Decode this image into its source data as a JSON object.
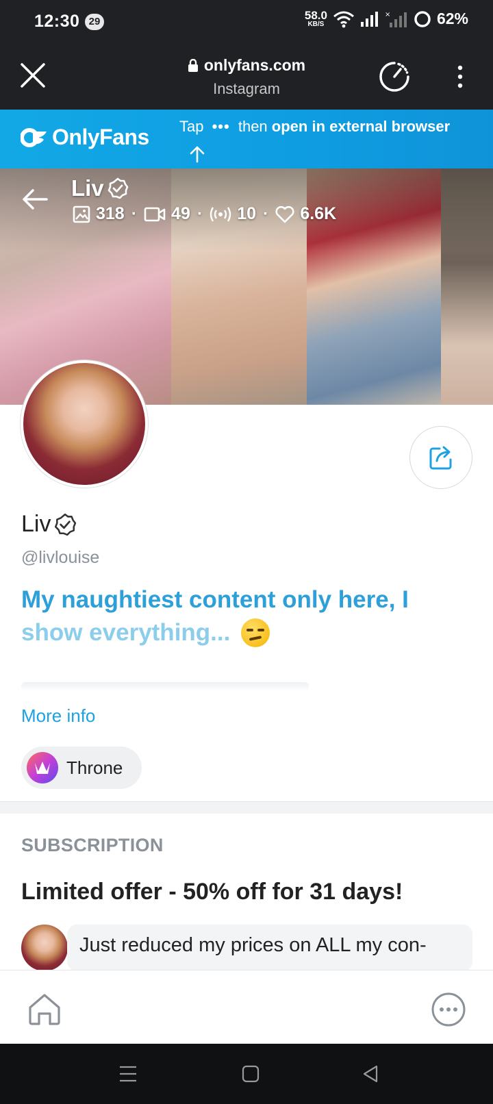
{
  "status_bar": {
    "time": "12:30",
    "notification_count": "29",
    "net_speed": "58.0",
    "net_speed_unit": "KB/S",
    "battery": "62%"
  },
  "browser": {
    "domain": "onlyfans.com",
    "source": "Instagram"
  },
  "banner": {
    "brand": "OnlyFans",
    "tip_prefix": "Tap",
    "tip_dots": "•••",
    "tip_middle": "then",
    "tip_bold": "open in external browser"
  },
  "profile": {
    "cover_name": "Liv",
    "stats": {
      "photos": "318",
      "videos": "49",
      "streams": "10",
      "likes": "6.6K"
    },
    "name": "Liv",
    "handle": "@livlouise",
    "bio_line1": "My naughtiest content only here, I",
    "bio_line2": "show everything...",
    "more_info": "More info",
    "chip_label": "Throne"
  },
  "subscription": {
    "heading": "SUBSCRIPTION",
    "offer": "Limited offer - 50% off for 31 days!",
    "message": "Just reduced my prices on ALL my con-"
  },
  "colors": {
    "of_blue": "#12a8e5",
    "link_blue": "#1da1df",
    "bio_blue": "#2d9fd9"
  },
  "icons": {
    "close": "close-icon",
    "lock": "lock-icon",
    "gauge": "gauge-icon",
    "menu": "more-vertical-icon",
    "back": "arrow-left-icon",
    "verified": "verified-icon",
    "share": "share-icon",
    "home": "home-icon",
    "more": "more-horizontal-icon"
  }
}
